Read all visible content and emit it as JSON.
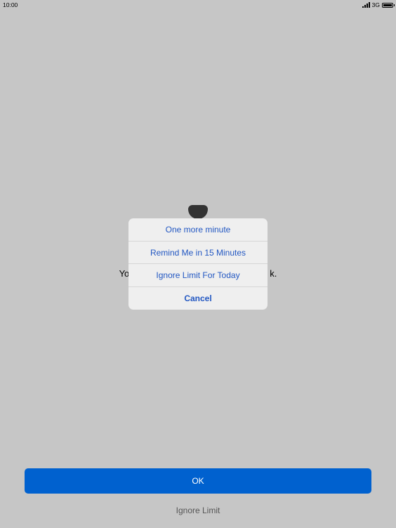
{
  "status_bar": {
    "time": "10:00",
    "network": "3G",
    "icons": [
      "signal-icon",
      "battery-icon"
    ]
  },
  "background": {
    "message_left": "Yo",
    "message_right": "k."
  },
  "action_sheet": {
    "items": [
      "One more minute",
      "Remind Me in 15 Minutes",
      "Ignore Limit For Today"
    ],
    "cancel": "Cancel",
    "accent_color": "#2257c2"
  },
  "footer": {
    "ok_label": "OK",
    "ignore_label": "Ignore Limit",
    "button_color": "#0061cf"
  }
}
